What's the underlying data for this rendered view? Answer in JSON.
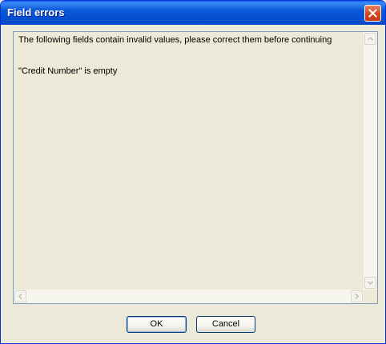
{
  "window": {
    "title": "Field errors"
  },
  "message": {
    "lines": [
      "The following fields contain invalid values, please correct them before continuing",
      "",
      "",
      "\"Credit Number\" is empty"
    ],
    "text": "The following fields contain invalid values, please correct them before continuing\n\n\n\"Credit Number\" is empty"
  },
  "buttons": {
    "ok_label": "OK",
    "cancel_label": "Cancel"
  },
  "icons": {
    "close": "close-icon",
    "scroll_up": "arrow-up-icon",
    "scroll_down": "arrow-down-icon",
    "scroll_left": "arrow-left-icon",
    "scroll_right": "arrow-right-icon"
  },
  "colors": {
    "titlebar": "#0a58d8",
    "close_button": "#d6461c",
    "dialog_background": "#ece9d8",
    "border": "#7f9db9"
  }
}
